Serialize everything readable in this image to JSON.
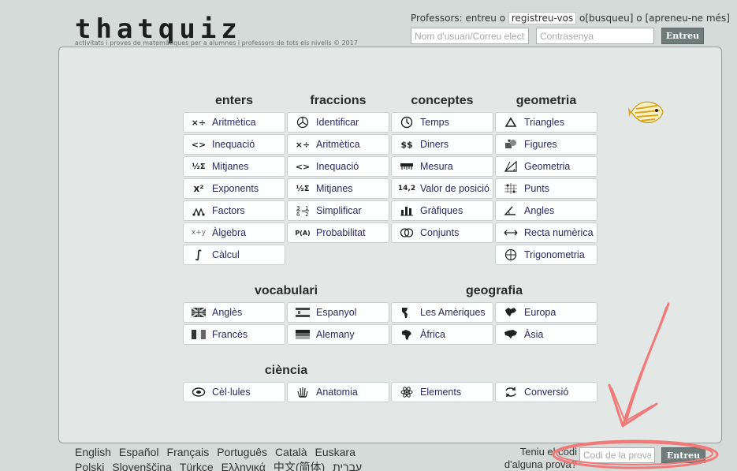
{
  "header": {
    "logo": "thatquiz",
    "tagline": "activitats i proves de matemàtiques per a alumnes i professors de tots els nivells © 2017"
  },
  "login": {
    "prefix": "Professors: entreu o",
    "register": "registreu-vos",
    "or1": "o",
    "search": "[busqueu]",
    "or2": "o",
    "learn_more": "[apreneu-ne més]",
    "user_placeholder": "Nom d'usuari/Correu electrònic",
    "password_placeholder": "Contrasenya",
    "submit": "Entreu"
  },
  "sections": {
    "enters": {
      "title": "enters",
      "items": [
        {
          "label": "Aritmètica",
          "icon": "arithmetic-icon"
        },
        {
          "label": "Inequació",
          "icon": "inequality-icon"
        },
        {
          "label": "Mitjanes",
          "icon": "averages-icon"
        },
        {
          "label": "Exponents",
          "icon": "exponent-icon"
        },
        {
          "label": "Factors",
          "icon": "factors-icon"
        },
        {
          "label": "Àlgebra",
          "icon": "algebra-icon"
        },
        {
          "label": "Càlcul",
          "icon": "integral-icon"
        }
      ]
    },
    "fraccions": {
      "title": "fraccions",
      "items": [
        {
          "label": "Identificar",
          "icon": "pie-icon"
        },
        {
          "label": "Aritmètica",
          "icon": "arithmetic-icon"
        },
        {
          "label": "Inequació",
          "icon": "inequality-icon"
        },
        {
          "label": "Mitjanes",
          "icon": "averages-icon"
        },
        {
          "label": "Simplificar",
          "icon": "simplify-icon"
        },
        {
          "label": "Probabilitat",
          "icon": "probability-icon"
        }
      ]
    },
    "conceptes": {
      "title": "conceptes",
      "items": [
        {
          "label": "Temps",
          "icon": "clock-icon"
        },
        {
          "label": "Diners",
          "icon": "money-icon"
        },
        {
          "label": "Mesura",
          "icon": "ruler-icon"
        },
        {
          "label": "Valor de posició",
          "icon": "place-value-icon"
        },
        {
          "label": "Gràfiques",
          "icon": "bar-chart-icon"
        },
        {
          "label": "Conjunts",
          "icon": "venn-icon"
        }
      ]
    },
    "geometria": {
      "title": "geometria",
      "items": [
        {
          "label": "Triangles",
          "icon": "triangle-icon"
        },
        {
          "label": "Figures",
          "icon": "shapes-icon"
        },
        {
          "label": "Geometria",
          "icon": "geometry-icon"
        },
        {
          "label": "Punts",
          "icon": "points-icon"
        },
        {
          "label": "Angles",
          "icon": "angle-icon"
        },
        {
          "label": "Recta numèrica",
          "icon": "number-line-icon"
        },
        {
          "label": "Trigonometria",
          "icon": "trigonometry-icon"
        }
      ]
    },
    "vocabulari": {
      "title": "vocabulari",
      "items": [
        {
          "label": "Anglès",
          "icon": "uk-flag-icon"
        },
        {
          "label": "Espanyol",
          "icon": "spain-flag-icon"
        },
        {
          "label": "Francès",
          "icon": "france-flag-icon"
        },
        {
          "label": "Alemany",
          "icon": "germany-flag-icon"
        }
      ]
    },
    "geografia": {
      "title": "geografia",
      "items": [
        {
          "label": "Les Amèriques",
          "icon": "americas-icon"
        },
        {
          "label": "Europa",
          "icon": "europe-icon"
        },
        {
          "label": "Àfrica",
          "icon": "africa-icon"
        },
        {
          "label": "Àsia",
          "icon": "asia-icon"
        }
      ]
    },
    "ciencia": {
      "title": "ciència",
      "items": [
        {
          "label": "Cèl·lules",
          "icon": "cell-icon"
        },
        {
          "label": "Anatomia",
          "icon": "hand-icon"
        },
        {
          "label": "Elements",
          "icon": "atom-icon"
        },
        {
          "label": "Conversió",
          "icon": "conversion-icon"
        }
      ]
    }
  },
  "icon_text": {
    "arithmetic": "×÷",
    "inequality": "<>",
    "averages": "½Σ",
    "exponent": "x²",
    "algebra": "x+y",
    "integral": "∫",
    "money": "$$",
    "place_value": "14,2",
    "probability": "P(A)"
  },
  "footer": {
    "languages_row1": [
      "English",
      "Español",
      "Français",
      "Português",
      "Català",
      "Euskara"
    ],
    "languages_row2": [
      "Polski",
      "Slovenščina",
      "Türkçe",
      "Ελληνικά",
      "中文(简体)",
      "עברית"
    ],
    "code_question_line1": "Teniu el codi",
    "code_question_line2": "d'alguna prova?",
    "code_placeholder": "Codi de la prova",
    "code_submit": "Entreu"
  },
  "colors": {
    "background": "#d4dbd9",
    "panel": "#e3e8e6",
    "button": "#6e7c7a",
    "link_text": "#2a2a60",
    "annotation": "#f07a7a"
  }
}
